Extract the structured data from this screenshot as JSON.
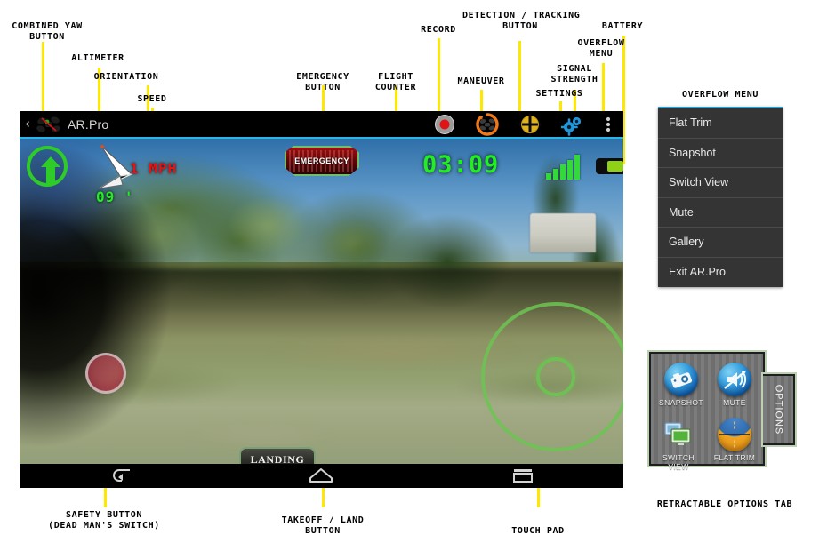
{
  "annotations": [
    {
      "id": "combined-yaw",
      "text": "COMBINED YAW\nBUTTON"
    },
    {
      "id": "altimeter",
      "text": "ALTIMETER"
    },
    {
      "id": "orientation",
      "text": "ORIENTATION"
    },
    {
      "id": "speed",
      "text": "SPEED"
    },
    {
      "id": "emergency",
      "text": "EMERGENCY\nBUTTON"
    },
    {
      "id": "flight-counter",
      "text": "FLIGHT\nCOUNTER"
    },
    {
      "id": "record",
      "text": "RECORD"
    },
    {
      "id": "maneuver",
      "text": "MANEUVER"
    },
    {
      "id": "detection-tracking",
      "text": "DETECTION / TRACKING\nBUTTON"
    },
    {
      "id": "settings",
      "text": "SETTINGS"
    },
    {
      "id": "signal-strength",
      "text": "SIGNAL\nSTRENGTH"
    },
    {
      "id": "overflow-menu",
      "text": "OVERFLOW\nMENU"
    },
    {
      "id": "battery",
      "text": "BATTERY"
    },
    {
      "id": "safety-button",
      "text": "SAFETY BUTTON\n(DEAD MAN'S SWITCH)"
    },
    {
      "id": "takeoff-land",
      "text": "TAKEOFF / LAND\nBUTTON"
    },
    {
      "id": "touch-pad",
      "text": "TOUCH PAD"
    },
    {
      "id": "overflow-menu-title",
      "text": "OVERFLOW MENU"
    },
    {
      "id": "options-tab-title",
      "text": "RETRACTABLE OPTIONS TAB"
    }
  ],
  "app": {
    "title": "AR.Pro",
    "back_label": "‹",
    "logo_name": "drone-logo-icon",
    "toolbar": [
      {
        "id": "record",
        "label": "Record"
      },
      {
        "id": "maneuver",
        "label": "Maneuver"
      },
      {
        "id": "detection",
        "label": "Detection / Tracking"
      },
      {
        "id": "settings",
        "label": "Settings"
      },
      {
        "id": "overflow",
        "label": "Overflow menu"
      }
    ]
  },
  "hud": {
    "yaw_label": "Combined yaw",
    "altitude": "09 '",
    "speed": "1 MPH",
    "emergency_label": "EMERGENCY",
    "flight_time": "03:09",
    "signal_bars": [
      6,
      10,
      15,
      20,
      26
    ],
    "signal_level": 5,
    "battery_percent": 64,
    "landing_label": "LANDING",
    "safety_label": "Safety button",
    "touchpad_label": "Touch pad"
  },
  "navbar": [
    {
      "id": "back",
      "label": "Back"
    },
    {
      "id": "home",
      "label": "Home"
    },
    {
      "id": "recents",
      "label": "Recents"
    }
  ],
  "overflow_menu": {
    "title": "OVERFLOW MENU",
    "items": [
      {
        "label": "Flat Trim"
      },
      {
        "label": "Snapshot"
      },
      {
        "label": "Switch View"
      },
      {
        "label": "Mute"
      },
      {
        "label": "Gallery"
      },
      {
        "label": "Exit AR.Pro"
      }
    ],
    "accent_color": "#2f9fd0"
  },
  "options_tab": {
    "title": "RETRACTABLE OPTIONS TAB",
    "tab_label": "OPTIONS",
    "icons": [
      {
        "id": "snapshot",
        "label": "SNAPSHOT",
        "icon": "camera-icon"
      },
      {
        "id": "mute",
        "label": "MUTE",
        "icon": "speaker-mute-icon"
      },
      {
        "id": "switch-view",
        "label": "SWITCH VIEW",
        "icon": "monitors-icon"
      },
      {
        "id": "flat-trim",
        "label": "FLAT TRIM",
        "icon": "horizon-icon"
      }
    ]
  },
  "colors": {
    "leader": "#ffe800",
    "hud_green": "#22ee22",
    "hud_red": "#ee1111",
    "accent_blue": "#29b6e8",
    "battery_green": "#8fd117"
  }
}
